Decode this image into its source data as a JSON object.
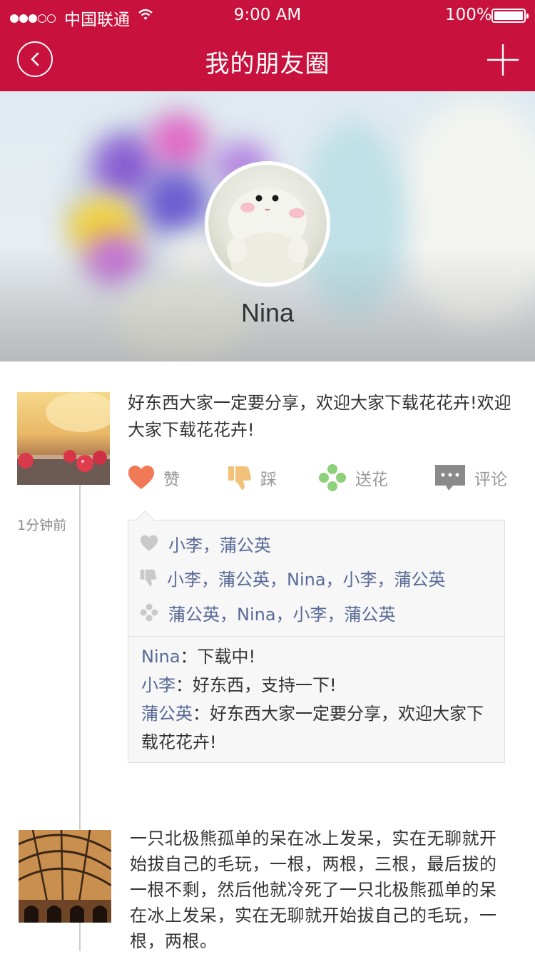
{
  "status_bar": {
    "carrier": "中国联通",
    "time": "9:00 AM",
    "battery": "100%"
  },
  "nav": {
    "title": "我的朋友圈",
    "back_icon": "chevron-left-circle-icon",
    "add_icon": "plus-icon",
    "color": "#c8123d"
  },
  "profile": {
    "name": "Nina"
  },
  "posts": [
    {
      "text": "好东西大家一定要分享，欢迎大家下载花花卉!欢迎大家下载花花卉!",
      "time": "1分钟前",
      "actions": [
        {
          "label": "赞",
          "icon": "heart-icon",
          "color": "#f07a55"
        },
        {
          "label": "踩",
          "icon": "thumbs-down-icon",
          "color": "#f2c27b"
        },
        {
          "label": "送花",
          "icon": "flower-icon",
          "color": "#8fd07a"
        },
        {
          "label": "评论",
          "icon": "comment-icon",
          "color": "#8a8a8a"
        }
      ],
      "likes": "小李，蒲公英",
      "dislikes": "小李，蒲公英，Nina，小李，蒲公英",
      "flowers": "蒲公英，Nina，小李，蒲公英",
      "comments": [
        {
          "author": "Nina",
          "text": "：下载中!"
        },
        {
          "author": "小李",
          "text": "：好东西，支持一下!"
        },
        {
          "author": "蒲公英",
          "text": "：好东西大家一定要分享，欢迎大家下载花花卉!"
        }
      ]
    },
    {
      "text": "一只北极熊孤单的呆在冰上发呆，实在无聊就开始拔自己的毛玩，一根，两根，三根，最后拔的一根不剩，然后他就冷死了一只北极熊孤单的呆在冰上发呆，实在无聊就开始拔自己的毛玩，一根，两根。"
    }
  ]
}
